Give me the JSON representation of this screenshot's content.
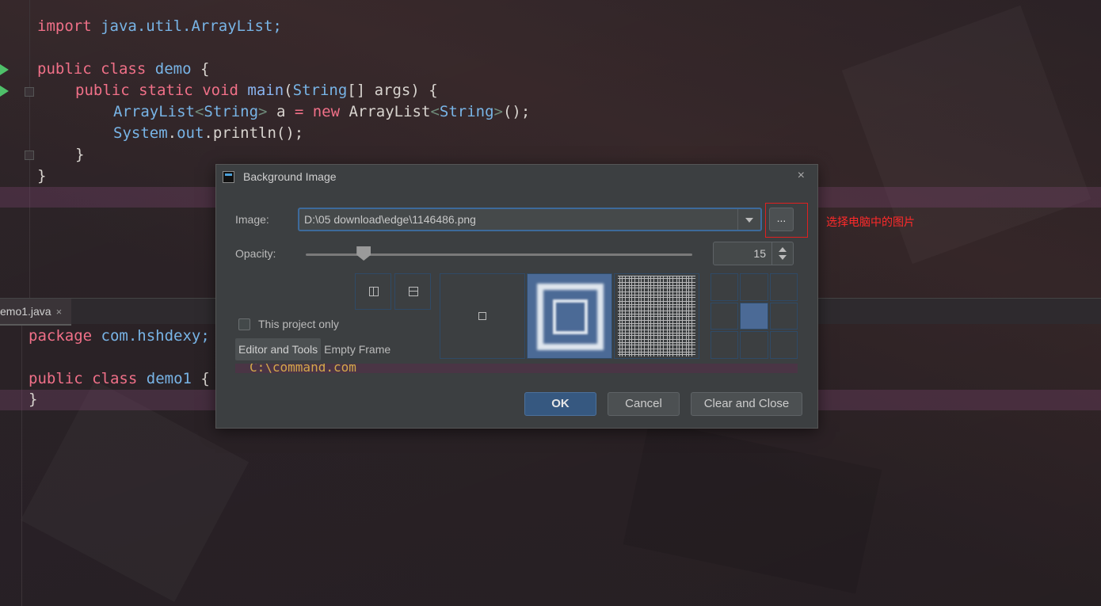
{
  "editor_top": {
    "line1": {
      "kw": "import",
      "rest": " java.util.ArrayList;"
    },
    "line3": {
      "kw1": "public",
      "kw2": "class",
      "name": "demo",
      "brace": " {"
    },
    "line4": {
      "kw1": "public",
      "kw2": "static",
      "kw3": "void",
      "fn": "main",
      "rest1": "(",
      "ty": "String",
      "rest2": "[] args) {"
    },
    "line5": {
      "ty1": "ArrayList",
      "lt": "<",
      "ty2": "String",
      "gt": ">",
      "mid": " a ",
      "eq": "=",
      "kw": " new",
      "mid2": " ArrayList",
      "lt2": "<",
      "ty3": "String",
      "gt2": ">",
      "end": "();"
    },
    "line6": {
      "cls": "System",
      "dot": ".",
      "fld": "out",
      "rest": ".println();"
    },
    "line7": "}",
    "line8": "}"
  },
  "editor_tab": {
    "label": "emo1.java",
    "close": "×"
  },
  "editor_bottom": {
    "line1": {
      "kw": "package",
      "rest": " com.hshdexy;"
    },
    "line3": {
      "kw1": "public",
      "kw2": "class",
      "name": "demo1",
      "brace": " {"
    },
    "line4": "}"
  },
  "dialog": {
    "title": "Background Image",
    "close_glyph": "×",
    "image_label": "Image:",
    "image_value": "D:\\05 download\\edge\\1146486.png",
    "browse_label": "...",
    "opacity_label": "Opacity:",
    "opacity_value": "15",
    "opacity_fraction": 0.15,
    "this_project_only": "This project only",
    "targets": [
      "Editor and Tools",
      "Empty Frame"
    ],
    "selected_target": 0,
    "preview_text": "C:\\command.com",
    "buttons": {
      "ok": "OK",
      "cancel": "Cancel",
      "clear": "Clear and Close"
    }
  },
  "annotation": {
    "text": "选择电脑中的图片",
    "color": "#ff2a2a"
  }
}
